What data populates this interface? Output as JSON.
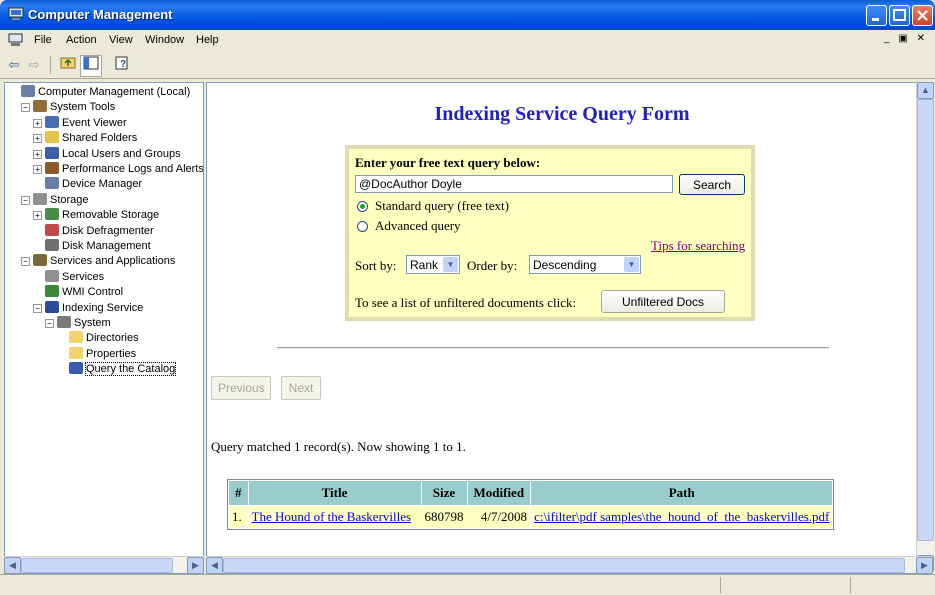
{
  "window": {
    "title": "Computer Management"
  },
  "menu": [
    "File",
    "Action",
    "View",
    "Window",
    "Help"
  ],
  "tree": [
    {
      "label": "Computer Management (Local)",
      "indent": 0,
      "exp": "",
      "icon": "computer-icon",
      "color": "#6A7FA8"
    },
    {
      "label": "System Tools",
      "indent": 1,
      "exp": "−",
      "icon": "tools-icon",
      "color": "#8F6E3A"
    },
    {
      "label": "Event Viewer",
      "indent": 2,
      "exp": "+",
      "icon": "event-viewer-icon",
      "color": "#4A6FB0"
    },
    {
      "label": "Shared Folders",
      "indent": 2,
      "exp": "+",
      "icon": "shared-folder-icon",
      "color": "#E5C34A"
    },
    {
      "label": "Local Users and Groups",
      "indent": 2,
      "exp": "+",
      "icon": "users-icon",
      "color": "#3A5FA5"
    },
    {
      "label": "Performance Logs and Alerts",
      "indent": 2,
      "exp": "+",
      "icon": "performance-icon",
      "color": "#8A5A2A"
    },
    {
      "label": "Device Manager",
      "indent": 2,
      "exp": "",
      "icon": "device-manager-icon",
      "color": "#6A7FA8"
    },
    {
      "label": "Storage",
      "indent": 1,
      "exp": "−",
      "icon": "storage-icon",
      "color": "#909090"
    },
    {
      "label": "Removable Storage",
      "indent": 2,
      "exp": "+",
      "icon": "removable-storage-icon",
      "color": "#4A8A4A"
    },
    {
      "label": "Disk Defragmenter",
      "indent": 2,
      "exp": "",
      "icon": "defrag-icon",
      "color": "#C24A4A"
    },
    {
      "label": "Disk Management",
      "indent": 2,
      "exp": "",
      "icon": "disk-management-icon",
      "color": "#707070"
    },
    {
      "label": "Services and Applications",
      "indent": 1,
      "exp": "−",
      "icon": "services-apps-icon",
      "color": "#7A6A3A"
    },
    {
      "label": "Services",
      "indent": 2,
      "exp": "",
      "icon": "services-icon",
      "color": "#909090"
    },
    {
      "label": "WMI Control",
      "indent": 2,
      "exp": "",
      "icon": "wmi-icon",
      "color": "#3A8A3A"
    },
    {
      "label": "Indexing Service",
      "indent": 2,
      "exp": "−",
      "icon": "indexing-icon",
      "color": "#2A4A9A"
    },
    {
      "label": "System",
      "indent": 3,
      "exp": "−",
      "icon": "catalog-icon",
      "color": "#7A7A7A"
    },
    {
      "label": "Directories",
      "indent": 4,
      "exp": "",
      "icon": "folder-icon",
      "color": "#F2D26A"
    },
    {
      "label": "Properties",
      "indent": 4,
      "exp": "",
      "icon": "folder-icon",
      "color": "#F2D26A"
    },
    {
      "label": "Query the Catalog",
      "indent": 4,
      "exp": "",
      "icon": "query-icon",
      "color": "#3A5AB0",
      "selected": true
    }
  ],
  "form": {
    "title": "Indexing Service Query Form",
    "prompt": "Enter your free text query below:",
    "query_value": "@DocAuthor Doyle",
    "search_label": "Search",
    "radio_standard": "Standard query (free text)",
    "radio_advanced": "Advanced query",
    "tips_link": "Tips for searching",
    "sort_label": "Sort by:",
    "sort_value": "Rank",
    "order_label": "Order by:",
    "order_value": "Descending",
    "unfiltered_text": "To see a list of unfiltered documents click:",
    "unfiltered_button": "Unfiltered Docs"
  },
  "nav": {
    "previous": "Previous",
    "next": "Next"
  },
  "results": {
    "summary": "Query matched 1 record(s). Now showing 1 to 1.",
    "headers": [
      "#",
      "Title",
      "Size",
      "Modified",
      "Path"
    ],
    "rows": [
      [
        "1.",
        "The Hound of the Baskervilles",
        "680798",
        "4/7/2008",
        "c:\\ifilter\\pdf samples\\the_hound_of_the_baskervilles.pdf"
      ]
    ]
  }
}
